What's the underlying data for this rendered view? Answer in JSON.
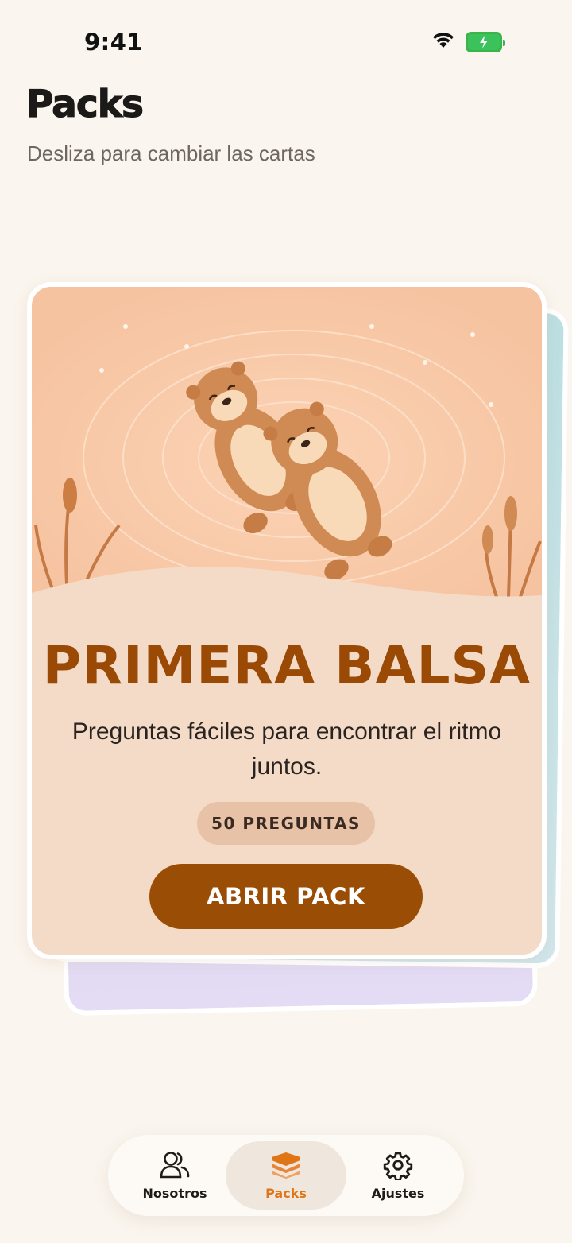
{
  "status_bar": {
    "time": "9:41",
    "icons": [
      "wifi-icon",
      "battery-charging-icon"
    ]
  },
  "header": {
    "title": "Packs",
    "subtitle": "Desliza para cambiar las cartas"
  },
  "pack_card": {
    "illustration": "two-otters-floating-icon",
    "title": "PRIMERA BALSA",
    "description": "Preguntas fáciles para encontrar el ritmo juntos.",
    "question_count_badge": "50 PREGUNTAS",
    "open_button_label": "ABRIR PACK"
  },
  "tab_bar": {
    "tabs": [
      {
        "label": "Nosotros",
        "icon": "people-icon",
        "active": false
      },
      {
        "label": "Packs",
        "icon": "stack-icon",
        "active": true
      },
      {
        "label": "Ajustes",
        "icon": "gear-icon",
        "active": false
      }
    ]
  },
  "colors": {
    "background": "#faf5ee",
    "accent": "#9a4d05",
    "active_tab": "#e07515",
    "card": "#f4dbc8"
  }
}
